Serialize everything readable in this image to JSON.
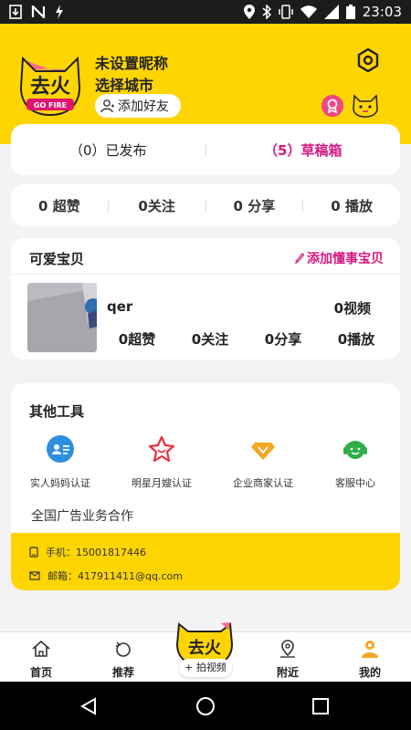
{
  "status_bar": {
    "time": "23:03"
  },
  "profile": {
    "logo_text": "去火",
    "logo_subtext": "GO FIRE",
    "nickname": "未设置昵称",
    "city": "选择城市",
    "add_friend": "添加好友"
  },
  "tabs": [
    {
      "label": "（0）已发布"
    },
    {
      "label": "（5）草稿箱"
    }
  ],
  "stats": [
    {
      "label": "0 超赞"
    },
    {
      "label": "0关注"
    },
    {
      "label": "0 分享"
    },
    {
      "label": "0 播放"
    }
  ],
  "baby": {
    "title": "可爱宝贝",
    "add_label": "添加懂事宝贝",
    "name": "qer",
    "videos": "0视频",
    "stats": [
      "0超赞",
      "0关注",
      "0分享",
      "0播放"
    ]
  },
  "tools": {
    "title": "其他工具",
    "items": [
      {
        "label": "实人妈妈认证",
        "icon": "id-card-icon"
      },
      {
        "label": "明星月嫂认证",
        "icon": "star-icon"
      },
      {
        "label": "企业商家认证",
        "icon": "diamond-icon"
      },
      {
        "label": "客服中心",
        "icon": "headset-icon"
      }
    ],
    "ad_line": "全国广告业务合作",
    "phone": "手机：15001817446",
    "email": "邮箱：417911411@qq.com"
  },
  "bottom_nav": [
    {
      "label": "首页"
    },
    {
      "label": "推荐"
    },
    {
      "label": "附近"
    },
    {
      "label": "我的"
    }
  ],
  "center_button": {
    "logo_text": "去火",
    "label": "+ 拍视频"
  },
  "colors": {
    "brand_yellow": "#fed501",
    "accent_pink": "#d7197f"
  }
}
